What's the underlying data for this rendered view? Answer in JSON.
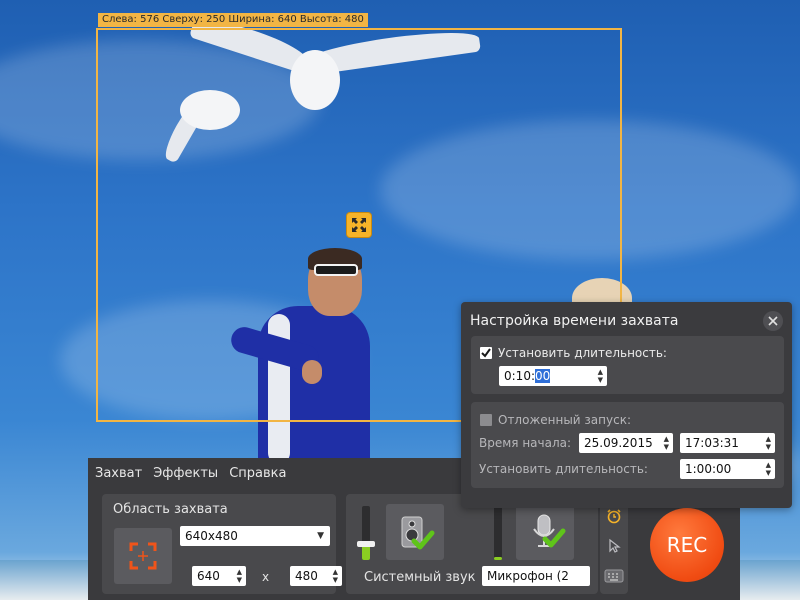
{
  "capture_area": {
    "info": "Слева: 576  Сверху: 250  Ширина: 640  Высота: 480"
  },
  "menu": {
    "items": [
      "Захват",
      "Эффекты",
      "Справка"
    ]
  },
  "capture_group": {
    "title": "Область захвата",
    "size_preset": "640x480",
    "width": "640",
    "height": "480",
    "times": "x"
  },
  "sound_group": {
    "system_label": "Системный звук",
    "system_volume": 0.3,
    "microphone_device": "Микрофон (2",
    "microphone_volume": 0.05
  },
  "rec_button": {
    "label": "REC"
  },
  "time_dialog": {
    "title": "Настройка времени захвата",
    "set_duration_label": "Установить длительность:",
    "set_duration_checked": true,
    "duration_value_prefix": "0:10:",
    "duration_value_selected": "00",
    "delayed_start_label": "Отложенный запуск:",
    "delayed_start_checked": false,
    "start_time_label": "Время начала:",
    "start_date": "25.09.2015",
    "start_time": "17:03:31",
    "delayed_duration_label": "Установить длительность:",
    "delayed_duration_value": "1:00:00"
  },
  "colors": {
    "capture_frame": "#f2b544",
    "rec_button": "#f04b12",
    "volume_fill": "#8acd22",
    "panel_bg": "#3a3a3d"
  }
}
